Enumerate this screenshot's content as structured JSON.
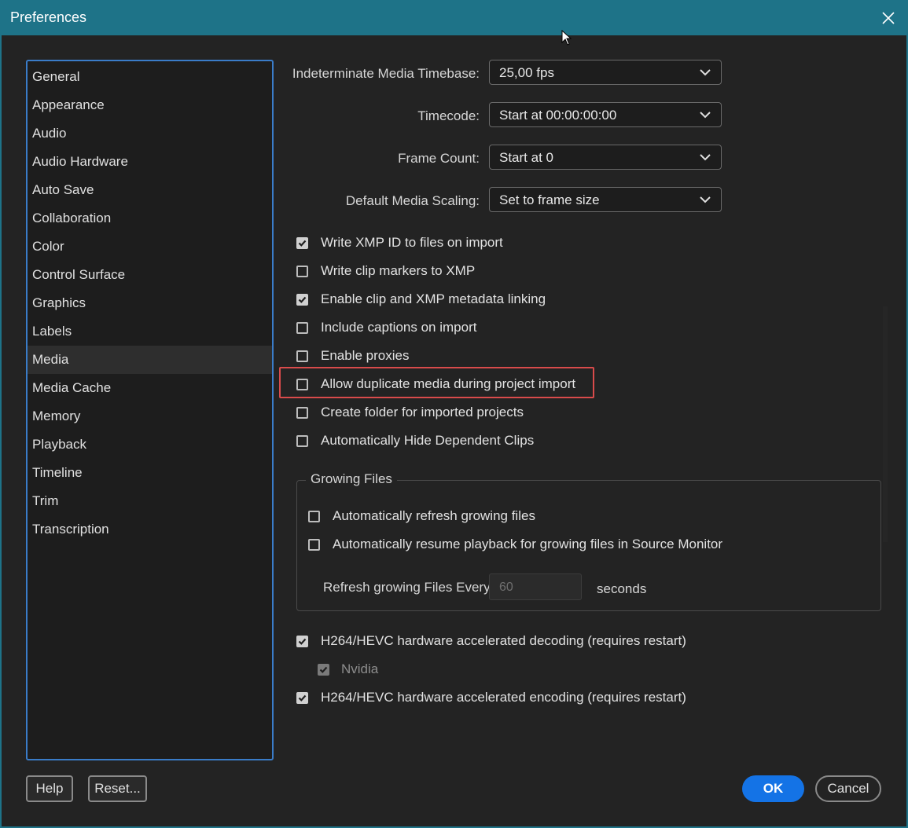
{
  "window": {
    "title": "Preferences"
  },
  "sidebar": {
    "items": [
      {
        "label": "General",
        "active": false
      },
      {
        "label": "Appearance",
        "active": false
      },
      {
        "label": "Audio",
        "active": false
      },
      {
        "label": "Audio Hardware",
        "active": false
      },
      {
        "label": "Auto Save",
        "active": false
      },
      {
        "label": "Collaboration",
        "active": false
      },
      {
        "label": "Color",
        "active": false
      },
      {
        "label": "Control Surface",
        "active": false
      },
      {
        "label": "Graphics",
        "active": false
      },
      {
        "label": "Labels",
        "active": false
      },
      {
        "label": "Media",
        "active": true
      },
      {
        "label": "Media Cache",
        "active": false
      },
      {
        "label": "Memory",
        "active": false
      },
      {
        "label": "Playback",
        "active": false
      },
      {
        "label": "Timeline",
        "active": false
      },
      {
        "label": "Trim",
        "active": false
      },
      {
        "label": "Transcription",
        "active": false
      }
    ]
  },
  "fields": {
    "timebase": {
      "label": "Indeterminate Media Timebase:",
      "value": "25,00 fps"
    },
    "timecode": {
      "label": "Timecode:",
      "value": "Start at 00:00:00:00"
    },
    "frame_count": {
      "label": "Frame Count:",
      "value": "Start at 0"
    },
    "scaling": {
      "label": "Default Media Scaling:",
      "value": "Set to frame size"
    }
  },
  "checks": {
    "write_xmp_id": {
      "label": "Write XMP ID to files on import",
      "checked": true
    },
    "write_clip_markers": {
      "label": "Write clip markers to XMP",
      "checked": false
    },
    "enable_metadata_linking": {
      "label": "Enable clip and XMP metadata linking",
      "checked": true
    },
    "include_captions": {
      "label": "Include captions on import",
      "checked": false
    },
    "enable_proxies": {
      "label": "Enable proxies",
      "checked": false
    },
    "allow_duplicate": {
      "label": "Allow duplicate media during project import",
      "checked": false
    },
    "create_folder": {
      "label": "Create folder for imported projects",
      "checked": false
    },
    "auto_hide": {
      "label": "Automatically Hide Dependent Clips",
      "checked": false
    },
    "refresh_growing": {
      "label": "Automatically refresh growing files",
      "checked": false
    },
    "resume_playback": {
      "label": "Automatically resume playback for growing files in Source Monitor",
      "checked": false
    },
    "hw_decoding": {
      "label": "H264/HEVC hardware accelerated decoding (requires restart)",
      "checked": true
    },
    "nvidia": {
      "label": "Nvidia",
      "checked": true,
      "disabled": true
    },
    "hw_encoding": {
      "label": "H264/HEVC hardware accelerated encoding (requires restart)",
      "checked": true
    }
  },
  "growing": {
    "title": "Growing Files",
    "refresh_label": "Refresh growing Files Every",
    "refresh_value": "60",
    "unit": "seconds"
  },
  "buttons": {
    "help": "Help",
    "reset": "Reset...",
    "ok": "OK",
    "cancel": "Cancel"
  },
  "colors": {
    "accent": "#1473e6",
    "titlebar": "#1e7388",
    "highlight": "#d94b4b"
  }
}
